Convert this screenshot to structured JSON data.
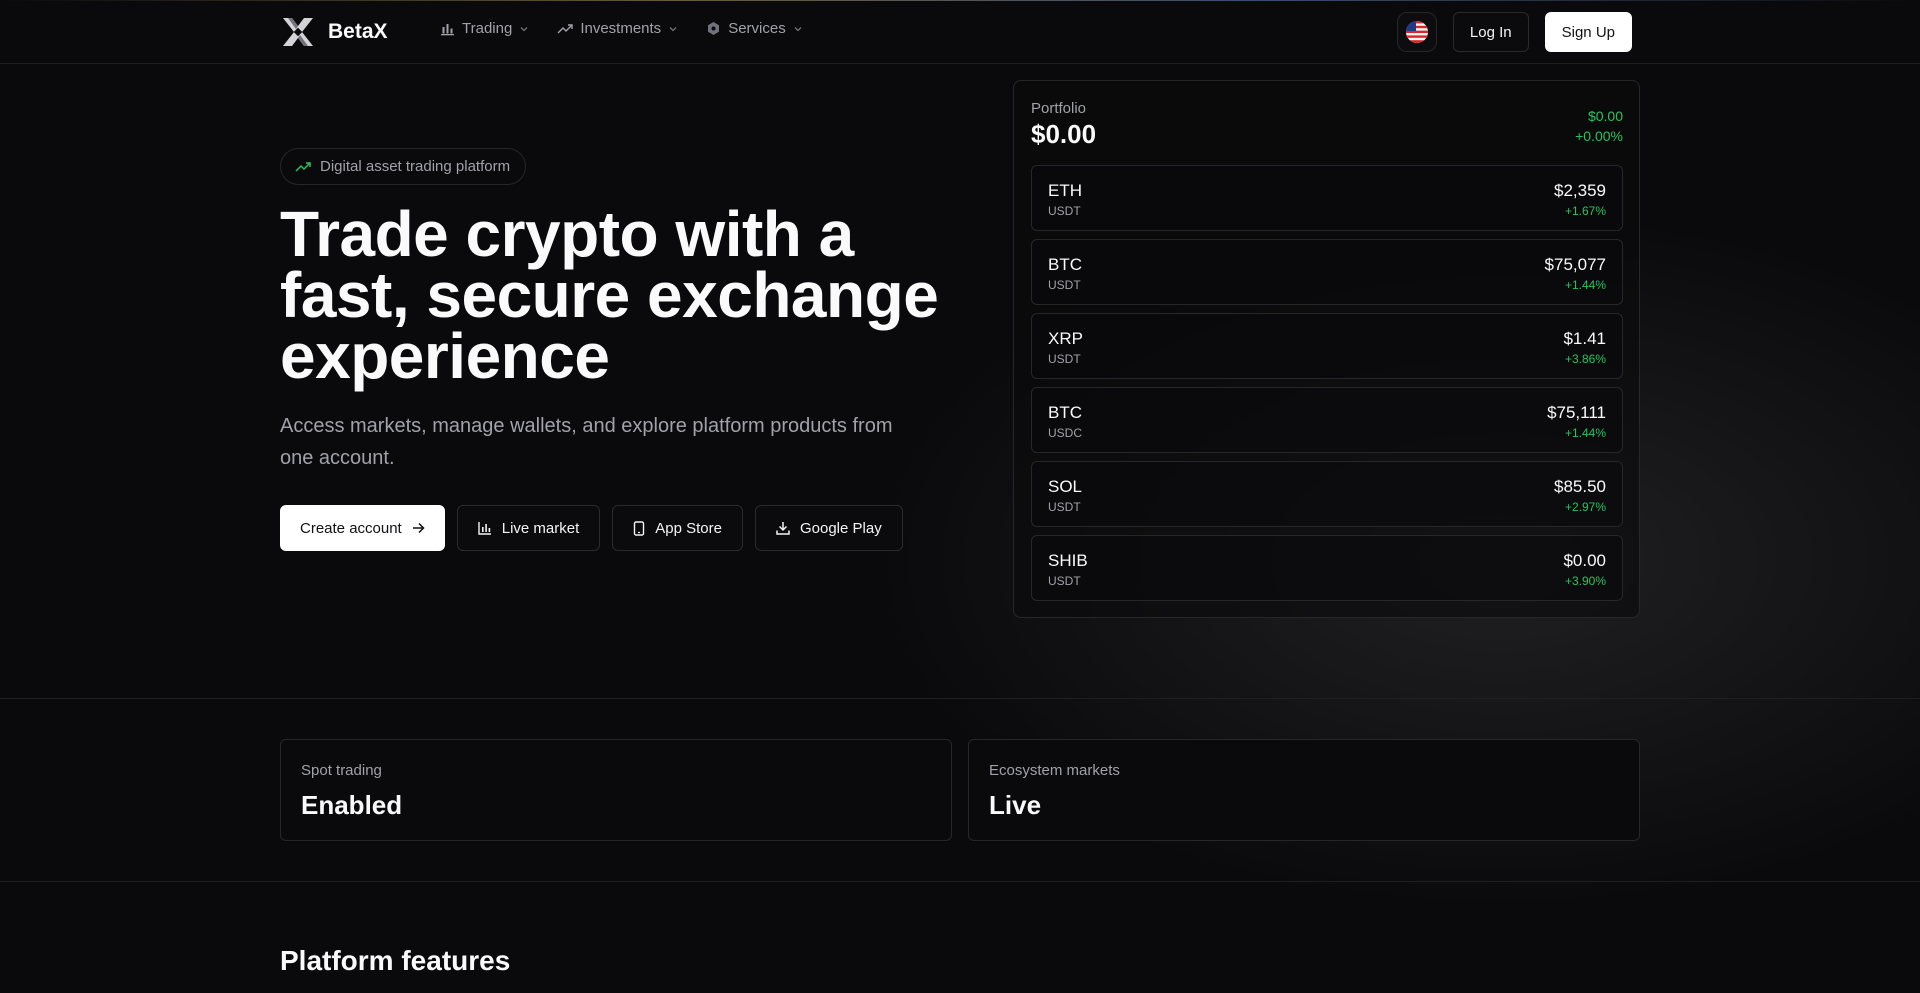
{
  "brand": {
    "name": "BetaX"
  },
  "nav": {
    "items": [
      {
        "label": "Trading",
        "icon": "bar-chart-icon"
      },
      {
        "label": "Investments",
        "icon": "trending-up-icon"
      },
      {
        "label": "Services",
        "icon": "hexagon-icon"
      }
    ]
  },
  "header": {
    "language_flag": "us-flag-icon",
    "login_label": "Log In",
    "signup_label": "Sign Up"
  },
  "hero": {
    "badge": "Digital asset trading platform",
    "title": "Trade crypto with a fast, secure exchange experience",
    "subtitle": "Access markets, manage wallets, and explore platform products from one account.",
    "actions": {
      "create_account": "Create account",
      "live_market": "Live market",
      "app_store": "App Store",
      "google_play": "Google Play"
    }
  },
  "portfolio": {
    "label": "Portfolio",
    "value": "$0.00",
    "change_amount": "$0.00",
    "change_percent": "+0.00%",
    "assets": [
      {
        "symbol": "ETH",
        "quote": "USDT",
        "price": "$2,359",
        "change": "+1.67%"
      },
      {
        "symbol": "BTC",
        "quote": "USDT",
        "price": "$75,077",
        "change": "+1.44%"
      },
      {
        "symbol": "XRP",
        "quote": "USDT",
        "price": "$1.41",
        "change": "+3.86%"
      },
      {
        "symbol": "BTC",
        "quote": "USDC",
        "price": "$75,111",
        "change": "+1.44%"
      },
      {
        "symbol": "SOL",
        "quote": "USDT",
        "price": "$85.50",
        "change": "+2.97%"
      },
      {
        "symbol": "SHIB",
        "quote": "USDT",
        "price": "$0.00",
        "change": "+3.90%"
      }
    ]
  },
  "stats": [
    {
      "label": "Spot trading",
      "value": "Enabled"
    },
    {
      "label": "Ecosystem markets",
      "value": "Live"
    }
  ],
  "features": {
    "title": "Platform features"
  },
  "colors": {
    "background": "#0a0a0c",
    "positive": "#22c55e",
    "muted_text": "#a1a1aa",
    "border": "#27272a",
    "primary_button": "#ffffff"
  }
}
